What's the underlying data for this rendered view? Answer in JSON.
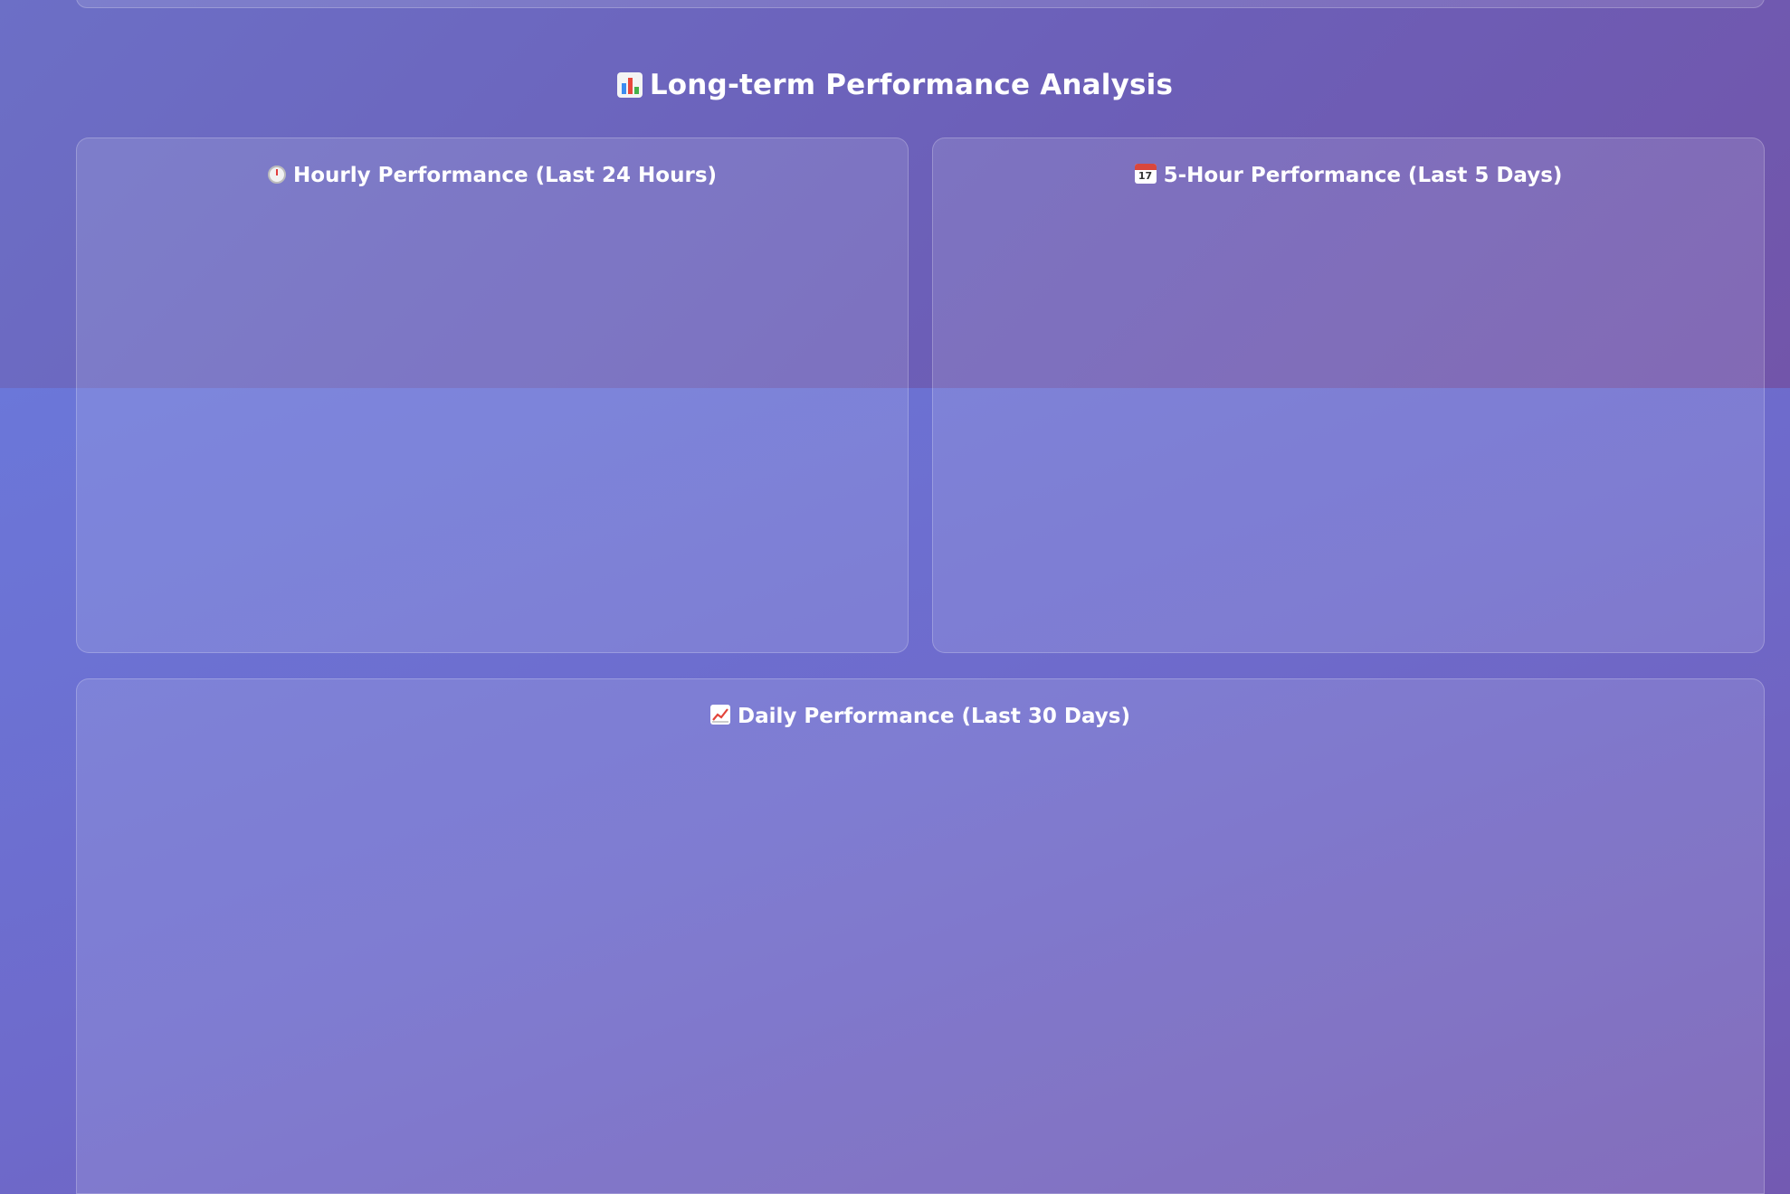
{
  "section": {
    "title": "Long-term Performance Analysis",
    "icon": "bar-chart-icon"
  },
  "panels": {
    "hourly": {
      "title": "Hourly Performance (Last 24 Hours)",
      "icon": "stopwatch-icon"
    },
    "five_hour": {
      "title": "5-Hour Performance (Last 5 Days)",
      "icon": "calendar-icon",
      "icon_text": "17"
    },
    "daily": {
      "title": "Daily Performance (Last 30 Days)",
      "icon": "chart-increasing-icon"
    }
  },
  "colors": {
    "background_start": "#6b78d8",
    "background_end": "#7452a8",
    "text": "#ffffff"
  }
}
